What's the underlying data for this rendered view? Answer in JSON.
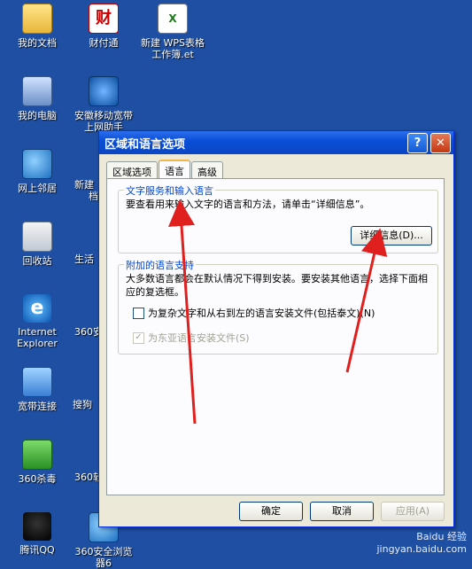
{
  "desktop": {
    "icons": [
      {
        "label": "我的文档",
        "icon": "folder-icon"
      },
      {
        "label": "我的电脑",
        "icon": "computer-icon"
      },
      {
        "label": "网上邻居",
        "icon": "network-icon"
      },
      {
        "label": "回收站",
        "icon": "recycle-bin-icon"
      },
      {
        "label": "Internet\nExplorer",
        "icon": "ie-icon"
      },
      {
        "label": "宽带连接",
        "icon": "broadband-icon"
      },
      {
        "label": "360杀毒",
        "icon": "shield-icon"
      },
      {
        "label": "腾讯QQ",
        "icon": "qq-icon"
      },
      {
        "label": "财付通",
        "icon": "caifutong-icon"
      },
      {
        "label": "安徽移动宽带\n上网助手",
        "icon": "mobile-icon"
      },
      {
        "label": "新建 WPS表格\n工作簿.et",
        "icon": "spreadsheet-icon"
      },
      {
        "label": "360安全浏览\n器6",
        "icon": "browser-icon"
      }
    ],
    "partial_labels": [
      "新建",
      "档",
      "生活",
      "360安",
      "搜狗",
      "360软"
    ]
  },
  "dialog": {
    "title": "区域和语言选项",
    "help_button": "?",
    "close_button": "✕",
    "tabs": [
      {
        "label": "区域选项",
        "active": false
      },
      {
        "label": "语言",
        "active": true
      },
      {
        "label": "高级",
        "active": false
      }
    ],
    "group1": {
      "label": "文字服务和输入语言",
      "text": "要查看用来输入文字的语言和方法，请单击“详细信息”。",
      "details_button": "详细信息(D)..."
    },
    "group2": {
      "label": "附加的语言支持",
      "text": "大多数语言都会在默认情况下得到安装。要安装其他语言，选择下面相应的复选框。",
      "checkbox1": {
        "label": "为复杂文字和从右到左的语言安装文件(包括泰文)(N)",
        "checked": false
      },
      "checkbox2": {
        "label": "为东亚语言安装文件(S)",
        "checked": true,
        "disabled": true
      }
    },
    "buttons": {
      "ok": "确定",
      "cancel": "取消",
      "apply": "应用(A)"
    }
  },
  "watermark": {
    "line1": "Baidu 经验",
    "line2": "jingyan.baidu.com"
  },
  "colors": {
    "desktop": "#1e4fa3",
    "titlebar": "#0a4fd6",
    "arrow": "#e0201e"
  }
}
